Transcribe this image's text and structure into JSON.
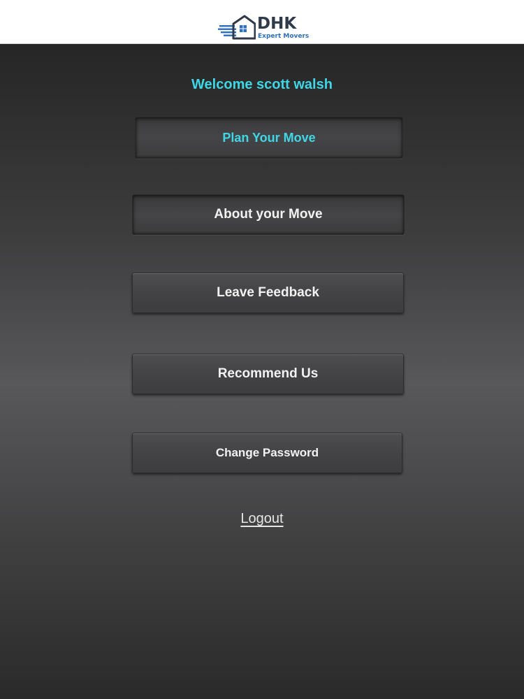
{
  "header": {
    "logo_name": "DHK",
    "logo_tagline": "Expert Movers"
  },
  "welcome_text": "Welcome scott walsh",
  "menu": {
    "plan_your_move": "Plan Your Move",
    "about_your_move": "About your Move",
    "leave_feedback": "Leave Feedback",
    "recommend_us": "Recommend Us",
    "change_password": "Change Password"
  },
  "logout_label": "Logout",
  "colors": {
    "accent": "#3fd6e6",
    "logo_dark": "#2f3a4a",
    "logo_blue": "#2f6fc0",
    "background_dark": "#262626"
  },
  "icons": {
    "logo_mark": "house-with-speed-lines-icon"
  }
}
